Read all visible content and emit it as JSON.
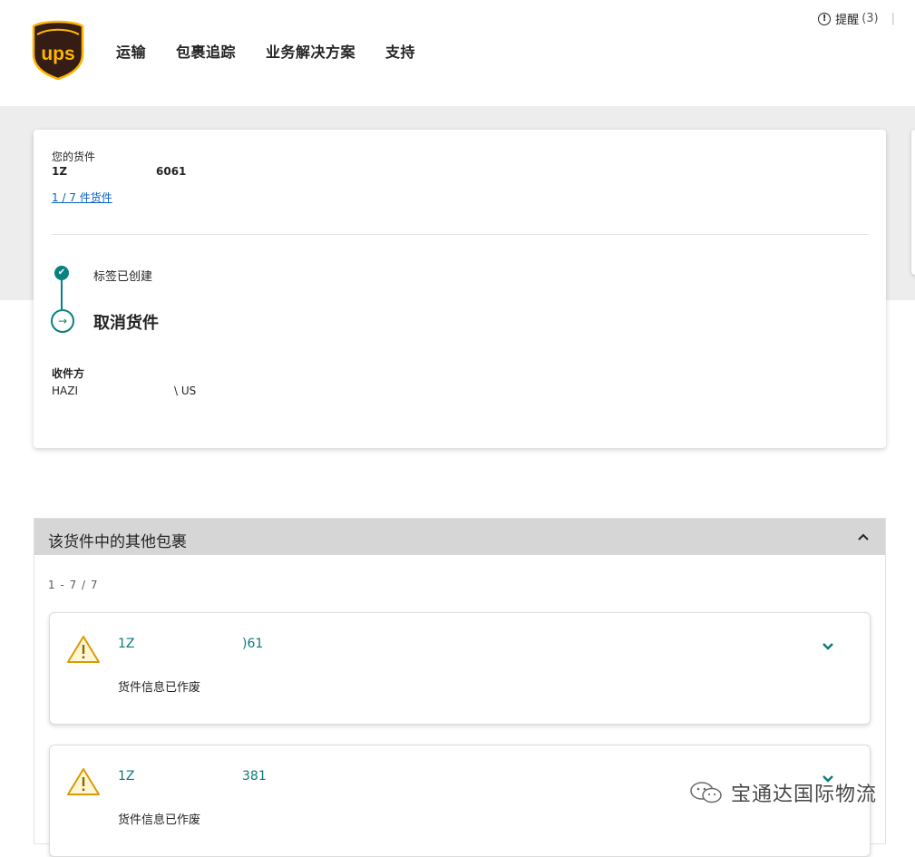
{
  "brand": {
    "logo_text": "ups",
    "primary_color": "#351c15",
    "gold_color": "#ffb500",
    "accent_teal": "#0a8080",
    "link_blue": "#0662bb"
  },
  "nav": {
    "items": [
      "运输",
      "包裹追踪",
      "业务解决方案",
      "支持"
    ]
  },
  "alerts": {
    "label": "提醒",
    "count": "(3)",
    "separator": "|",
    "icon": "alert-circle-icon"
  },
  "shipment": {
    "label": "您的货件",
    "tracking_prefix": "1Z",
    "tracking_suffix": "6061",
    "count_link": "1 / 7 件货件"
  },
  "progress": {
    "steps": [
      {
        "label": "标签已创建",
        "status": "done",
        "icon": "check-circle-icon"
      },
      {
        "label": "取消货件",
        "status": "current",
        "icon": "arrow-circle-icon"
      }
    ]
  },
  "recipient": {
    "label": "收件方",
    "name": "HAZI",
    "region": "\\ US"
  },
  "packages_panel": {
    "title": "该货件中的其他包裹",
    "range": "1 - 7 / 7",
    "collapse_icon": "chevron-up-icon",
    "items": [
      {
        "tracking_prefix": "1Z",
        "tracking_suffix": ")61",
        "status": "货件信息已作废",
        "icon": "warning-triangle-icon"
      },
      {
        "tracking_prefix": "1Z",
        "tracking_suffix": "381",
        "status": "货件信息已作废",
        "icon": "warning-triangle-icon"
      }
    ]
  },
  "watermark": {
    "text": "宝通达国际物流",
    "icon": "wechat-icon"
  }
}
